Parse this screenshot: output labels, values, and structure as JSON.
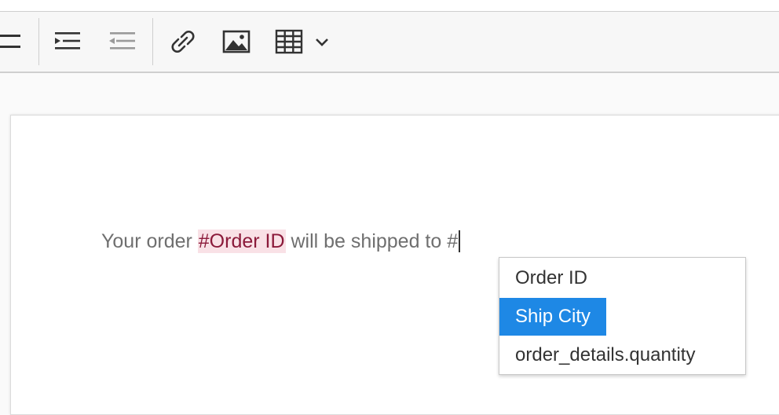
{
  "toolbar": {
    "buttons": [
      {
        "name": "align-justify-icon"
      },
      {
        "name": "indent-increase-icon"
      },
      {
        "name": "indent-decrease-icon"
      },
      {
        "name": "link-icon"
      },
      {
        "name": "image-icon"
      },
      {
        "name": "table-icon"
      },
      {
        "name": "chevron-down-icon"
      }
    ]
  },
  "editor": {
    "text_before": "Your order ",
    "token": "#Order ID",
    "text_after": " will be shipped to #"
  },
  "mention_popup": {
    "items": [
      {
        "label": "Order ID",
        "selected": false
      },
      {
        "label": "Ship City",
        "selected": true
      },
      {
        "label": "order_details.quantity",
        "selected": false
      }
    ]
  },
  "colors": {
    "accent": "#1e88e5",
    "token_bg": "#f9e1e6",
    "token_text": "#8b1a3a"
  }
}
